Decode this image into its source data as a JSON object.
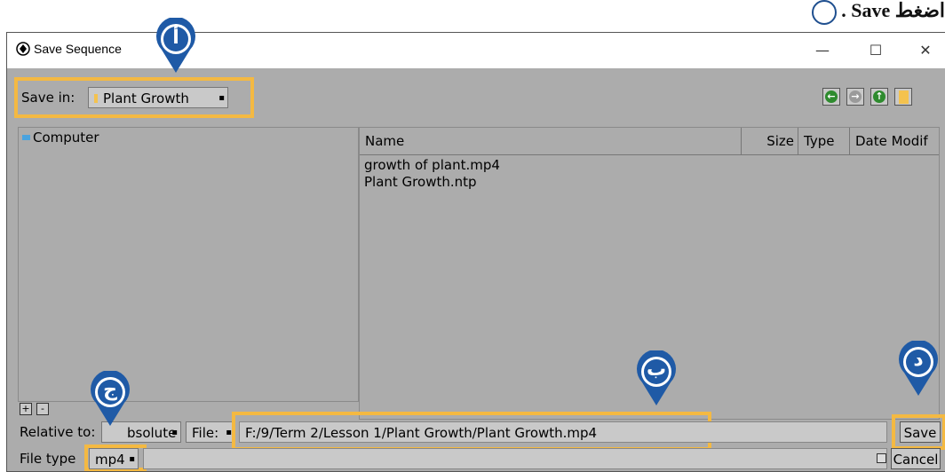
{
  "instruction": {
    "text": "اضغط Save ."
  },
  "window": {
    "title": "Save Sequence",
    "controls": {
      "minimize": "—",
      "maximize": "☐",
      "close": "✕"
    }
  },
  "save_in": {
    "label": "Save in:",
    "value": "Plant Growth"
  },
  "tree": {
    "root": "Computer"
  },
  "columns": {
    "name": "Name",
    "size": "Size",
    "type": "Type",
    "date": "Date Modif"
  },
  "files": [
    "growth of plant.mp4",
    "Plant Growth.ntp"
  ],
  "tree_buttons": {
    "plus": "+",
    "minus": "-"
  },
  "relative": {
    "label": "Relative to:",
    "value": "Absolute",
    "visible_value": "bsolute"
  },
  "file_mode": {
    "value": "File:"
  },
  "path": {
    "value": "F:/9/Term 2/Lesson 1/Plant Growth/Plant Growth.mp4"
  },
  "file_type": {
    "label": "File type:",
    "visible_label": "File type",
    "value": "mp4"
  },
  "actions": {
    "save": "Save",
    "cancel": "Cancel"
  },
  "markers": {
    "a": "أ",
    "b": "ب",
    "c": "ج",
    "d": "د"
  },
  "colors": {
    "highlight": "#f4b942",
    "marker": "#1f5aa6",
    "window_bg": "#acacac"
  }
}
